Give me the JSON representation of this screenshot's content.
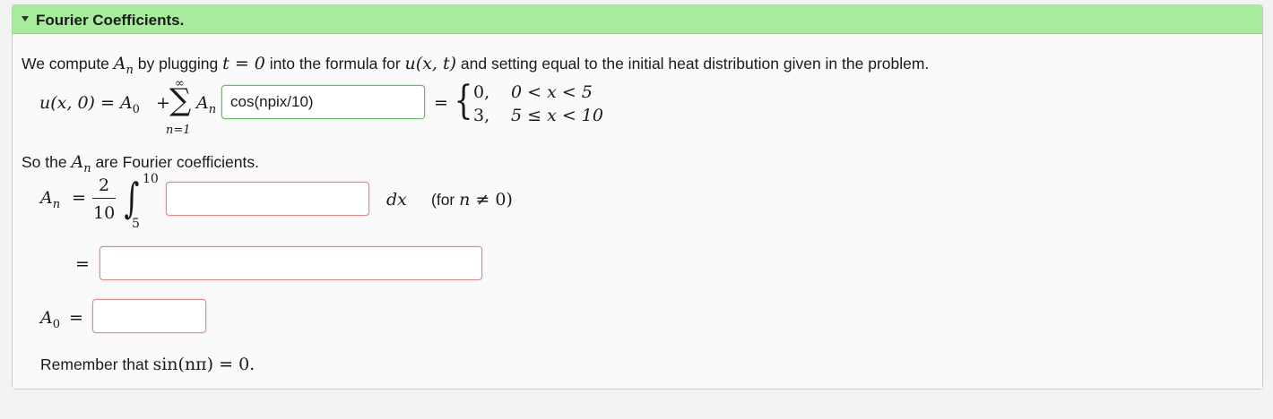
{
  "panel": {
    "title": "Fourier Coefficients.",
    "expand_icon": "caret-down-icon"
  },
  "intro": {
    "t1": "We compute ",
    "A": "A",
    "n": "n",
    "t2": " by plugging ",
    "eq": "t = 0",
    "t3": " into the formula for ",
    "uxt": "u(x, t)",
    "t4": " and setting equal to the initial heat distribution given in the problem."
  },
  "series": {
    "lhs": "u(x, 0) = A",
    "sub0": "0",
    "plus": "+",
    "sum_symbol": "∑",
    "sum_top": "∞",
    "sum_bottom": "n=1",
    "An": "A",
    "An_sub": "n",
    "input_value": "cos(npix/10)",
    "equals": "=",
    "case1_value": "0,",
    "case1_cond": "0 < x < 5",
    "case2_value": "3,",
    "case2_cond": "5 ≤ x < 10"
  },
  "fourier": {
    "t1": "So the ",
    "A": "A",
    "n": "n",
    "t2": " are Fourier coefficients."
  },
  "integral": {
    "An": "A",
    "An_sub": "n",
    "equals": "=",
    "frac_num": "2",
    "frac_den": "10",
    "int_symbol": "∫",
    "upper": "10",
    "lower": "5",
    "input_value": "",
    "dx": "dx",
    "note_prefix": "(for ",
    "note_n": "n",
    "note_neq": " ≠ 0)"
  },
  "second": {
    "equals": "=",
    "input_value": ""
  },
  "a0": {
    "A": "A",
    "sub0": "0",
    "equals": "=",
    "input_value": ""
  },
  "remember": {
    "text": "Remember that ",
    "expr": "sin(nπ) = 0."
  }
}
